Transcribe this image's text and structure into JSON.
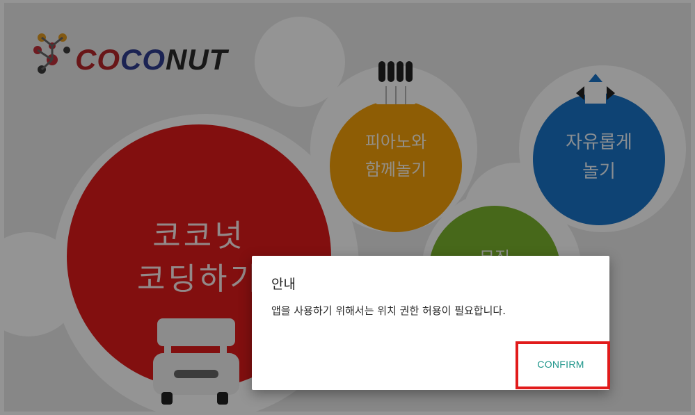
{
  "app": {
    "logo_text_parts": [
      {
        "text": "CO",
        "color": "#b5262a"
      },
      {
        "text": "CO",
        "color": "#2f3d8f"
      },
      {
        "text": "NUT",
        "color": "#2a2a2a"
      }
    ],
    "logo_dot_colors": [
      "#e09a22",
      "#3b3b3b",
      "#c0303a"
    ]
  },
  "menu": {
    "coding": {
      "label": "코코넛\n코딩하기",
      "color": "#e01b1b"
    },
    "piano": {
      "label": "피아노와\n함께놀기",
      "color": "#f4a00a"
    },
    "free_play": {
      "label": "자유롭게\n놀기",
      "color": "#1974c8"
    },
    "music": {
      "label": "뮤직",
      "color": "#7ab32d"
    }
  },
  "dialog": {
    "title": "안내",
    "message": "앱을 사용하기 위해서는 위치 권한 허용이 필요합니다.",
    "confirm_label": "CONFIRM"
  },
  "colors": {
    "accent": "#1c9489",
    "highlight": "#e11b1b"
  }
}
